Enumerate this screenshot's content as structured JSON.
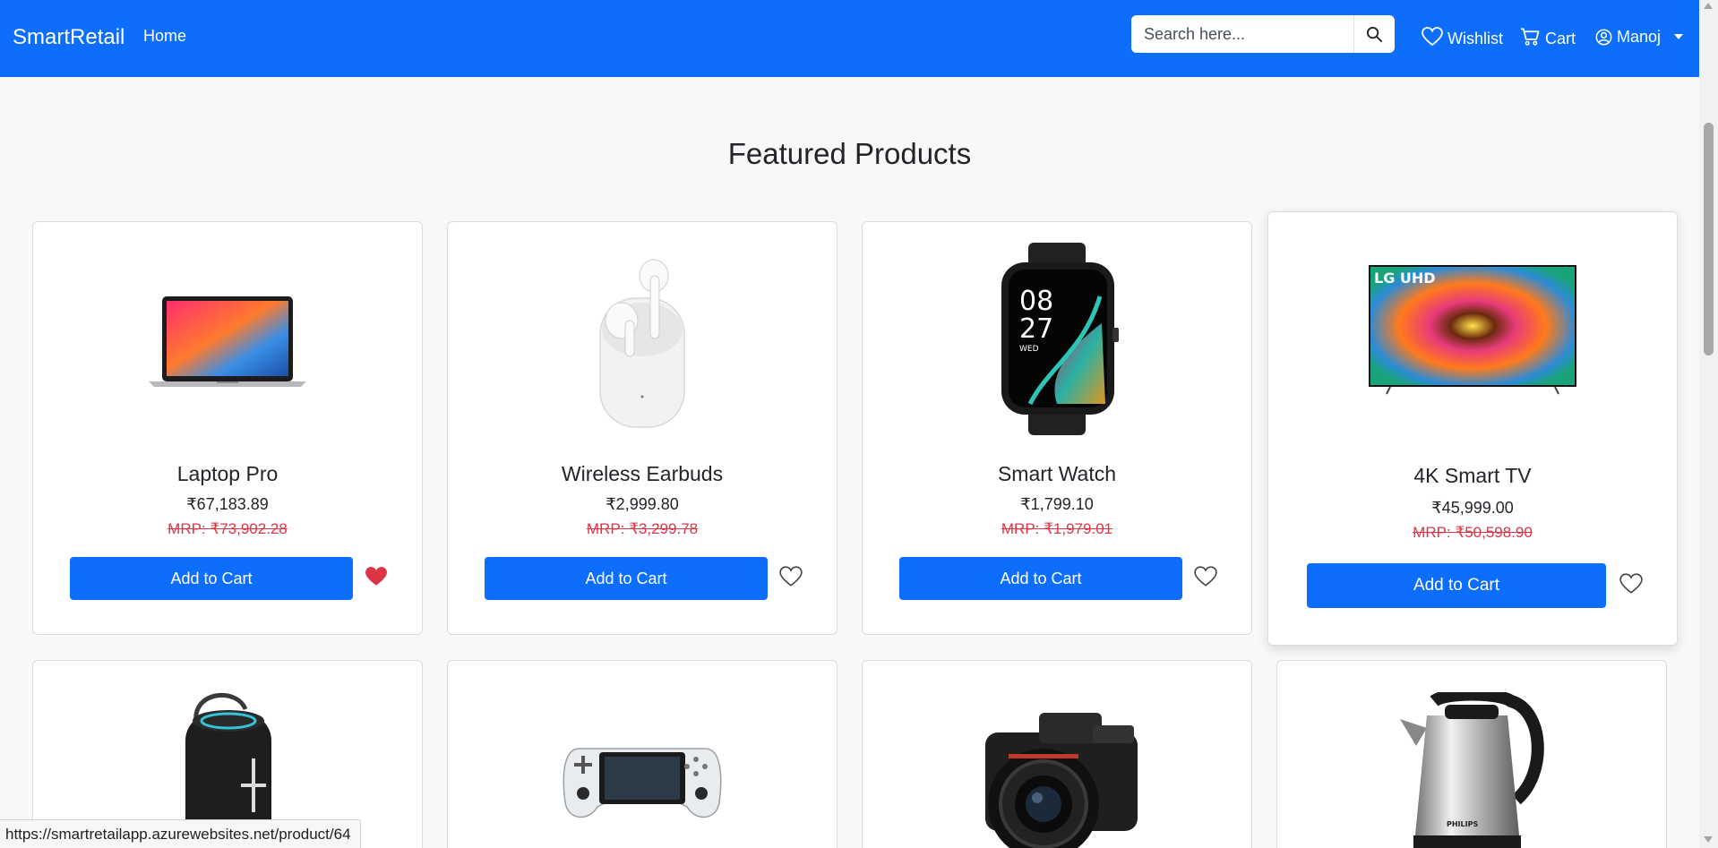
{
  "navbar": {
    "brand": "SmartRetail",
    "home": "Home",
    "search_placeholder": "Search here...",
    "wishlist": "Wishlist",
    "cart": "Cart",
    "user": "Manoj"
  },
  "page_title": "Featured Products",
  "products": [
    {
      "name": "Laptop Pro",
      "price": "₹67,183.89",
      "mrp": "MRP: ₹73,902.28",
      "button": "Add to Cart",
      "wishlisted": true,
      "image": "laptop"
    },
    {
      "name": "Wireless Earbuds",
      "price": "₹2,999.80",
      "mrp": "MRP: ₹3,299.78",
      "button": "Add to Cart",
      "wishlisted": false,
      "image": "earbuds"
    },
    {
      "name": "Smart Watch",
      "price": "₹1,799.10",
      "mrp": "MRP: ₹1,979.01",
      "button": "Add to Cart",
      "wishlisted": false,
      "image": "smartwatch"
    },
    {
      "name": "4K Smart TV",
      "price": "₹45,999.00",
      "mrp": "MRP: ₹50,598.90",
      "button": "Add to Cart",
      "wishlisted": false,
      "image": "tv"
    }
  ],
  "product_images_row2": [
    "speaker",
    "game-console",
    "camera",
    "kettle"
  ],
  "watch_face": {
    "hour": "08",
    "minute": "27",
    "day": "WED"
  },
  "tv_brand": "LG UHD",
  "kettle_brand": "PHILIPS",
  "status_url": "https://smartretailapp.azurewebsites.net/product/64",
  "colors": {
    "primary": "#0d6efd",
    "mrp": "#dc3545",
    "heart_active": "#dc3545"
  }
}
